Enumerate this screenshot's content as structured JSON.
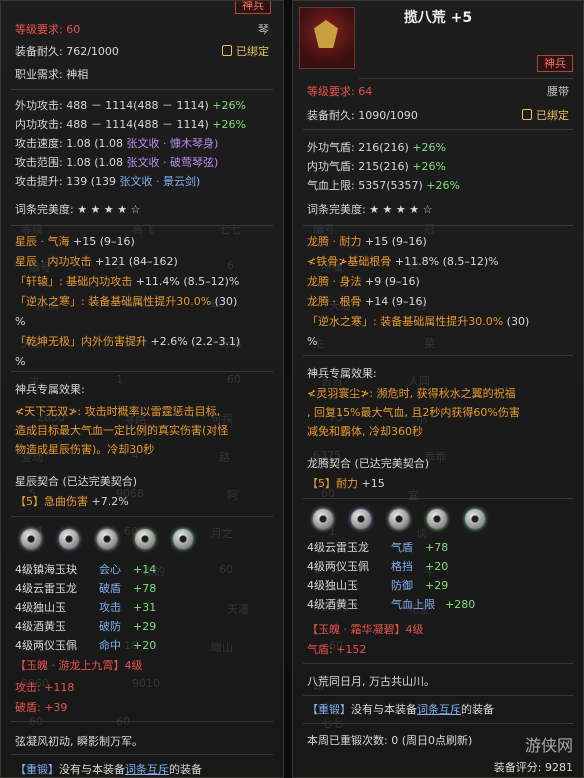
{
  "left": {
    "tag": "神兵",
    "level_req": "等级要求: 60",
    "type": "琴",
    "durability": "装备耐久: 762/1000",
    "bound": "已绑定",
    "job": "职业需求: 神相",
    "stats": [
      {
        "label": "外功攻击: 488 － 1114(488 － 1114)",
        "bonus": " +26%"
      },
      {
        "label": "内功攻击: 488 － 1114(488 － 1114)",
        "bonus": " +26%"
      },
      {
        "label": "攻击速度: 1.08 (1.08 ",
        "ext": "张文收 · 慷木琴身)"
      },
      {
        "label": "攻击范围: 1.08 (1.08 ",
        "ext": "张文收 · 破莺琴弦)"
      },
      {
        "label": "攻击提升: 139 (139 ",
        "ext": "张文收 · 景云剑)"
      }
    ],
    "perfection": "词条完美度: ★ ★ ★ ★ ☆",
    "affixes": [
      {
        "name": "星辰 · 气海",
        "val": " +15 (9–16)"
      },
      {
        "name": "星辰 · 内功攻击",
        "val": " +121 (84–162)"
      },
      {
        "name": "「轩辕」: 基础内功攻击",
        "val": " +11.4% (8.5–12)%"
      },
      {
        "name": "「逆水之寒」: 装备基础属性提升30.0%",
        "val": " (30)"
      },
      {
        "name": "%",
        "val": ""
      },
      {
        "name": "「乾坤无极」内外伤害提升",
        "val": " +2.6% (2.2–3.1)"
      },
      {
        "name": "%",
        "val": ""
      }
    ],
    "special_title": "神兵专属效果:",
    "special_lines": [
      "≮天下无双≯: 攻击时概率以雷霆惩击目标,",
      "造成目标最大气血一定比例的真实伤害(对怪",
      "物造成星辰伤害)。冷却30秒"
    ],
    "combo_title": "星辰契合 (已达完美契合)",
    "combo_effect": "【5】急曲伤害",
    "combo_bonus": " +7.2%",
    "jades": [
      {
        "name": "4级镇海玉玦",
        "stat": "会心",
        "val": "+14"
      },
      {
        "name": "4级云雷玉龙",
        "stat": "破盾",
        "val": "+78"
      },
      {
        "name": "4级独山玉",
        "stat": "攻击",
        "val": "+31"
      },
      {
        "name": "4级酒黄玉",
        "stat": "破防",
        "val": "+29"
      },
      {
        "name": "4级两仪玉佩",
        "stat": "命中",
        "val": "+20"
      }
    ],
    "soul": "【玉魄 · 游龙上九霄】4级",
    "soul_stats": [
      "攻击: +118",
      "破盾: +39"
    ],
    "poem": "弦凝风初动, 瞬影制万军。",
    "reforge_tag": "【重锻】",
    "reforge_text_a": "没有与本装备",
    "reforge_link": "词条互斥",
    "reforge_text_b": "的装备",
    "ghost": [
      "等级",
      "编号",
      "所属",
      "天猫",
      "主",
      "2050",
      "爱动",
      "5",
      "1",
      "孤天",
      "吉吉",
      "72",
      "8960",
      "60",
      "高飞",
      "2",
      "9102",
      "60",
      "1",
      "寻路",
      "4",
      "9068",
      "60",
      "一家的",
      "1",
      "18",
      "9010",
      "60",
      "七七",
      "6",
      "60",
      "玩偶",
      "60",
      "可探",
      "路",
      "阿",
      "月之",
      "60",
      "天瀑",
      "瞰山"
    ]
  },
  "right": {
    "title": "揽八荒 +5",
    "tag": "神兵",
    "level_req": "等级要求: 64",
    "type": "腰带",
    "durability": "装备耐久: 1090/1090",
    "bound": "已绑定",
    "stats": [
      {
        "label": "外功气盾: 216(216)",
        "bonus": " +26%"
      },
      {
        "label": "内功气盾: 215(216)",
        "bonus": " +26%"
      },
      {
        "label": "气血上限: 5357(5357)",
        "bonus": " +26%"
      }
    ],
    "perfection": "词条完美度: ★ ★ ★ ★ ☆",
    "affixes": [
      {
        "name": "龙腾 · 耐力",
        "val": " +15 (9–16)"
      },
      {
        "name": "≮铁骨≯基础根骨",
        "val": " +11.8% (8.5–12)%"
      },
      {
        "name": "龙腾 · 身法",
        "val": " +9 (9–16)"
      },
      {
        "name": "龙腾 · 根骨",
        "val": " +14 (9–16)"
      },
      {
        "name": "「逆水之寒」: 装备基础属性提升30.0%",
        "val": " (30)"
      },
      {
        "name": "%",
        "val": ""
      }
    ],
    "special_title": "神兵专属效果:",
    "special_lines": [
      "≮灵羽寰尘≯: 濒危时, 获得秋水之翼的祝福",
      ", 回复15%最大气血, 且2秒内获得60%伤害",
      "减免和霸体, 冷却360秒"
    ],
    "combo_title": "龙腾契合 (已达完美契合)",
    "combo_effect": "【5】耐力",
    "combo_bonus": " +15",
    "jades": [
      {
        "name": "4级云雷玉龙",
        "stat": "气盾",
        "val": "+78"
      },
      {
        "name": "4级两仪玉佩",
        "stat": "格挡",
        "val": "+20"
      },
      {
        "name": "4级独山玉",
        "stat": "防御",
        "val": "+29"
      },
      {
        "name": "4级酒黄玉",
        "stat": "气血上限",
        "val": "+280"
      }
    ],
    "soul": "【玉魄 · 霜华凝碧】4级",
    "soul_stats": [
      "气盾: +152"
    ],
    "poem": "八荒同日月, 万古共山川。",
    "reforge_tag": "【重锻】",
    "reforge_text_a": "没有与本装备",
    "reforge_link": "词条互斥",
    "reforge_text_b": "的装备",
    "weekly": "本周已重锻次数: 0 (周日0点刷新)",
    "score": "装备评分: 9281",
    "watermark": "游侠网",
    "ghost": [
      "编号",
      "所属",
      "天猫",
      "主",
      "吉吉",
      "73",
      "6375",
      "60",
      "1",
      "1",
      "2050",
      "60",
      "路",
      "七七",
      "冠",
      "阿",
      "邪",
      "菜",
      "人同",
      "小",
      "乖乖",
      "宜",
      "谈",
      "芊",
      "花室"
    ]
  },
  "colors": {
    "gold": "#e8c35a",
    "red": "#e8524a",
    "orange": "#e89a2e",
    "green": "#7ee07a",
    "purple": "#b78cf0",
    "blue": "#7fb0f0"
  }
}
